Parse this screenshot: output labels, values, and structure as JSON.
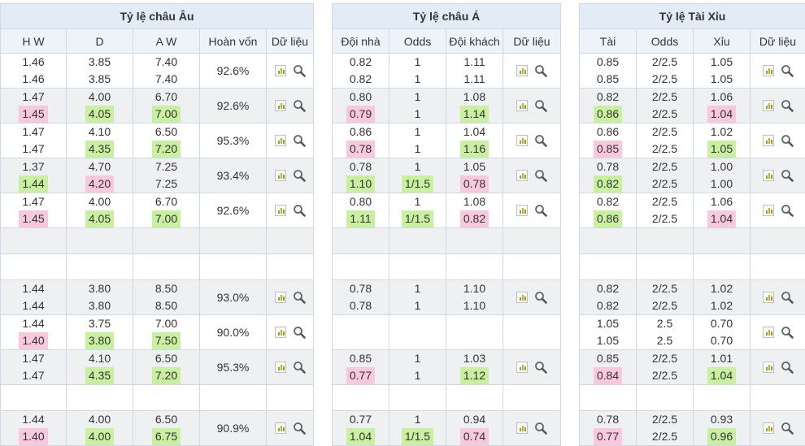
{
  "eu": {
    "title": "Tỷ lệ châu Âu",
    "headers": [
      "H W",
      "D",
      "A W",
      "Hoàn vốn",
      "Dữ liệu"
    ],
    "rows": [
      {
        "hw": [
          "1.46",
          "1.46"
        ],
        "d": [
          "3.85",
          "3.85"
        ],
        "aw": [
          "7.40",
          "7.40"
        ],
        "payout": "92.6%",
        "hwc": [
          "",
          ""
        ],
        "dc": [
          "",
          ""
        ],
        "awc": [
          "",
          ""
        ]
      },
      {
        "hw": [
          "1.47",
          "1.45"
        ],
        "d": [
          "4.00",
          "4.05"
        ],
        "aw": [
          "6.70",
          "7.00"
        ],
        "payout": "92.6%",
        "hwc": [
          "",
          "down"
        ],
        "dc": [
          "",
          "up"
        ],
        "awc": [
          "",
          "up"
        ]
      },
      {
        "hw": [
          "1.47",
          "1.47"
        ],
        "d": [
          "4.10",
          "4.35"
        ],
        "aw": [
          "6.50",
          "7.20"
        ],
        "payout": "95.3%",
        "hwc": [
          "",
          ""
        ],
        "dc": [
          "",
          "up"
        ],
        "awc": [
          "",
          "up"
        ]
      },
      {
        "hw": [
          "1.37",
          "1.44"
        ],
        "d": [
          "4.70",
          "4.20"
        ],
        "aw": [
          "7.25",
          "7.25"
        ],
        "payout": "93.4%",
        "hwc": [
          "",
          "up"
        ],
        "dc": [
          "",
          "down"
        ],
        "awc": [
          "",
          ""
        ]
      },
      {
        "hw": [
          "1.47",
          "1.45"
        ],
        "d": [
          "4.00",
          "4.05"
        ],
        "aw": [
          "6.70",
          "7.00"
        ],
        "payout": "92.6%",
        "hwc": [
          "",
          "down"
        ],
        "dc": [
          "",
          "up"
        ],
        "awc": [
          "",
          "up"
        ]
      },
      null,
      null,
      {
        "hw": [
          "1.44",
          "1.44"
        ],
        "d": [
          "3.80",
          "3.80"
        ],
        "aw": [
          "8.50",
          "8.50"
        ],
        "payout": "93.0%",
        "hwc": [
          "",
          ""
        ],
        "dc": [
          "",
          ""
        ],
        "awc": [
          "",
          ""
        ]
      },
      {
        "hw": [
          "1.44",
          "1.40"
        ],
        "d": [
          "3.75",
          "3.80"
        ],
        "aw": [
          "7.00",
          "7.50"
        ],
        "payout": "90.0%",
        "hwc": [
          "",
          "down"
        ],
        "dc": [
          "",
          "up"
        ],
        "awc": [
          "",
          "up"
        ]
      },
      {
        "hw": [
          "1.47",
          "1.47"
        ],
        "d": [
          "4.10",
          "4.35"
        ],
        "aw": [
          "6.50",
          "7.20"
        ],
        "payout": "95.3%",
        "hwc": [
          "",
          ""
        ],
        "dc": [
          "",
          "up"
        ],
        "awc": [
          "",
          "up"
        ]
      },
      null,
      {
        "hw": [
          "1.44",
          "1.40"
        ],
        "d": [
          "4.00",
          "4.00"
        ],
        "aw": [
          "6.50",
          "6.75"
        ],
        "payout": "90.9%",
        "hwc": [
          "",
          "down"
        ],
        "dc": [
          "",
          "up"
        ],
        "awc": [
          "",
          "up"
        ]
      }
    ]
  },
  "asia": {
    "title": "Tỷ lệ châu Á",
    "headers": [
      "Đội nhà",
      "Odds",
      "Đội khách",
      "Dữ liệu"
    ],
    "rows": [
      {
        "home": [
          "0.82",
          "0.82"
        ],
        "odds": [
          "1",
          "1"
        ],
        "away": [
          "1.11",
          "1.11"
        ],
        "hc": [
          "",
          ""
        ],
        "oc": [
          "",
          ""
        ],
        "ac": [
          "",
          ""
        ]
      },
      {
        "home": [
          "0.80",
          "0.79"
        ],
        "odds": [
          "1",
          "1"
        ],
        "away": [
          "1.08",
          "1.14"
        ],
        "hc": [
          "",
          "down"
        ],
        "oc": [
          "",
          ""
        ],
        "ac": [
          "",
          "up"
        ]
      },
      {
        "home": [
          "0.86",
          "0.78"
        ],
        "odds": [
          "1",
          "1"
        ],
        "away": [
          "1.04",
          "1.16"
        ],
        "hc": [
          "",
          "down"
        ],
        "oc": [
          "",
          ""
        ],
        "ac": [
          "",
          "up"
        ]
      },
      {
        "home": [
          "0.78",
          "1.10"
        ],
        "odds": [
          "1",
          "1/1.5"
        ],
        "away": [
          "1.05",
          "0.78"
        ],
        "hc": [
          "",
          "up"
        ],
        "oc": [
          "",
          "up"
        ],
        "ac": [
          "",
          "down"
        ]
      },
      {
        "home": [
          "0.80",
          "1.11"
        ],
        "odds": [
          "1",
          "1/1.5"
        ],
        "away": [
          "1.08",
          "0.82"
        ],
        "hc": [
          "",
          "up"
        ],
        "oc": [
          "",
          "up"
        ],
        "ac": [
          "",
          "down"
        ]
      },
      null,
      null,
      {
        "home": [
          "0.78",
          "0.78"
        ],
        "odds": [
          "1",
          "1"
        ],
        "away": [
          "1.10",
          "1.10"
        ],
        "hc": [
          "",
          ""
        ],
        "oc": [
          "",
          ""
        ],
        "ac": [
          "",
          ""
        ]
      },
      null,
      {
        "home": [
          "0.85",
          "0.77"
        ],
        "odds": [
          "1",
          "1"
        ],
        "away": [
          "1.03",
          "1.12"
        ],
        "hc": [
          "",
          "down"
        ],
        "oc": [
          "",
          ""
        ],
        "ac": [
          "",
          "up"
        ]
      },
      null,
      {
        "home": [
          "0.77",
          "1.04"
        ],
        "odds": [
          "1",
          "1/1.5"
        ],
        "away": [
          "0.94",
          "0.74"
        ],
        "hc": [
          "",
          "up"
        ],
        "oc": [
          "",
          "up"
        ],
        "ac": [
          "",
          "down"
        ]
      }
    ]
  },
  "ou": {
    "title": "Tỷ lệ Tài Xỉu",
    "headers": [
      "Tài",
      "Odds",
      "Xỉu",
      "Dữ liệu"
    ],
    "rows": [
      {
        "over": [
          "0.85",
          "0.85"
        ],
        "odds": [
          "2/2.5",
          "2/2.5"
        ],
        "under": [
          "1.05",
          "1.05"
        ],
        "oc": [
          "",
          ""
        ],
        "dc": [
          "",
          ""
        ],
        "uc": [
          "",
          ""
        ]
      },
      {
        "over": [
          "0.82",
          "0.86"
        ],
        "odds": [
          "2/2.5",
          "2/2.5"
        ],
        "under": [
          "1.06",
          "1.04"
        ],
        "oc": [
          "",
          "up"
        ],
        "dc": [
          "",
          ""
        ],
        "uc": [
          "",
          "down"
        ]
      },
      {
        "over": [
          "0.86",
          "0.85"
        ],
        "odds": [
          "2/2.5",
          "2/2.5"
        ],
        "under": [
          "1.02",
          "1.05"
        ],
        "oc": [
          "",
          "down"
        ],
        "dc": [
          "",
          ""
        ],
        "uc": [
          "",
          "up"
        ]
      },
      {
        "over": [
          "0.78",
          "0.82"
        ],
        "odds": [
          "2/2.5",
          "2/2.5"
        ],
        "under": [
          "1.00",
          "1.00"
        ],
        "oc": [
          "",
          "up"
        ],
        "dc": [
          "",
          ""
        ],
        "uc": [
          "",
          ""
        ]
      },
      {
        "over": [
          "0.82",
          "0.86"
        ],
        "odds": [
          "2/2.5",
          "2/2.5"
        ],
        "under": [
          "1.06",
          "1.04"
        ],
        "oc": [
          "",
          "up"
        ],
        "dc": [
          "",
          ""
        ],
        "uc": [
          "",
          "down"
        ]
      },
      null,
      null,
      {
        "over": [
          "0.82",
          "0.82"
        ],
        "odds": [
          "2/2.5",
          "2/2.5"
        ],
        "under": [
          "1.02",
          "1.02"
        ],
        "oc": [
          "",
          ""
        ],
        "dc": [
          "",
          ""
        ],
        "uc": [
          "",
          ""
        ]
      },
      {
        "over": [
          "1.05",
          "1.05"
        ],
        "odds": [
          "2.5",
          "2.5"
        ],
        "under": [
          "0.70",
          "0.70"
        ],
        "oc": [
          "",
          ""
        ],
        "dc": [
          "",
          ""
        ],
        "uc": [
          "",
          ""
        ]
      },
      {
        "over": [
          "0.85",
          "0.84"
        ],
        "odds": [
          "2/2.5",
          "2/2.5"
        ],
        "under": [
          "1.01",
          "1.04"
        ],
        "oc": [
          "",
          "down"
        ],
        "dc": [
          "",
          ""
        ],
        "uc": [
          "",
          "up"
        ]
      },
      null,
      {
        "over": [
          "0.78",
          "0.77"
        ],
        "odds": [
          "2/2.5",
          "2/2.5"
        ],
        "under": [
          "0.93",
          "0.96"
        ],
        "oc": [
          "",
          "down"
        ],
        "dc": [
          "",
          ""
        ],
        "uc": [
          "",
          "up"
        ]
      }
    ]
  },
  "colors": {
    "up": "#c8f0a0",
    "down": "#f8c8dc",
    "header": "#e3ecf6",
    "subheader": "#eef3fa",
    "alt": "#eef0f2",
    "border": "#cfd8e3"
  },
  "icons": {
    "chart": "bar-chart-icon",
    "search": "magnifier-icon"
  }
}
